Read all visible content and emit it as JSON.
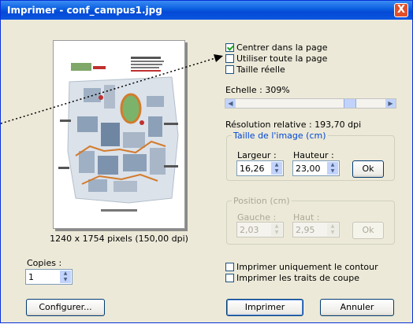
{
  "window": {
    "title": "Imprimer - conf_campus1.jpg",
    "close_label": "X"
  },
  "preview": {
    "image_info": "1240 x 1754 pixels (150,00 dpi)"
  },
  "options": [
    {
      "label": "Centrer dans la page",
      "checked": true
    },
    {
      "label": "Utiliser toute la page",
      "checked": false
    },
    {
      "label": "Taille réelle",
      "checked": false
    }
  ],
  "scale": {
    "label": "Echelle : 309%",
    "value_percent": 309
  },
  "resolution": {
    "label": "Résolution relative : 193,70 dpi"
  },
  "image_size": {
    "group_label": "Taille de l'image (cm)",
    "width_label": "Largeur :",
    "width_value": "16,26",
    "height_label": "Hauteur :",
    "height_value": "23,00",
    "ok_label": "Ok"
  },
  "position": {
    "group_label": "Position (cm)",
    "left_label": "Gauche :",
    "left_value": "2,03",
    "top_label": "Haut :",
    "top_value": "2,95",
    "ok_label": "Ok"
  },
  "copies": {
    "label": "Copies :",
    "value": "1"
  },
  "print_options": [
    {
      "label": "Imprimer uniquement le contour",
      "checked": false
    },
    {
      "label": "Imprimer les traits de coupe",
      "checked": false
    }
  ],
  "buttons": {
    "configure": "Configurer...",
    "print": "Imprimer",
    "cancel": "Annuler"
  },
  "colors": {
    "titlebar": "#0a5ee0",
    "dialog_bg": "#ece9d8",
    "group_label": "#0046d5",
    "close_button": "#e1502a"
  },
  "icons": [
    "close-icon",
    "check-icon",
    "spin-up-icon",
    "spin-down-icon",
    "scroll-left-icon",
    "scroll-right-icon"
  ]
}
